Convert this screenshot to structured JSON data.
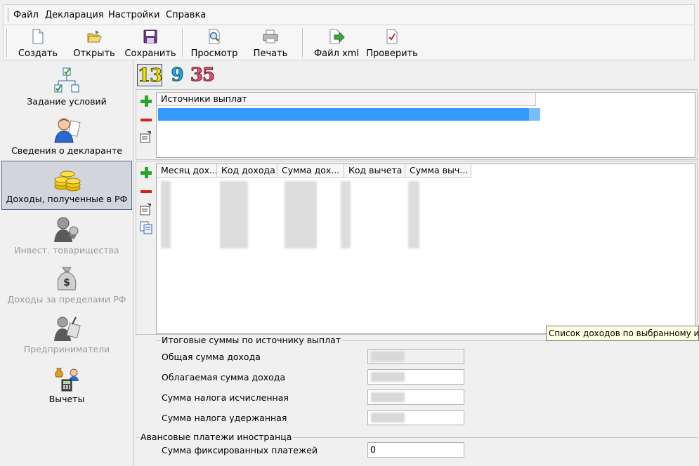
{
  "menu": [
    "Файл",
    "Декларация",
    "Настройки",
    "Справка"
  ],
  "toolbar": {
    "create": "Создать",
    "open": "Открыть",
    "save": "Сохранить",
    "preview": "Просмотр",
    "print": "Печать",
    "xml": "Файл xml",
    "check": "Проверить"
  },
  "sidebar": {
    "items": [
      {
        "label": "Задание условий",
        "icon": "conditions-icon"
      },
      {
        "label": "Сведения о декларанте",
        "icon": "declarant-icon"
      },
      {
        "label": "Доходы, полученные в РФ",
        "icon": "coins-icon"
      },
      {
        "label": "Инвест. товарищества",
        "icon": "partnership-icon"
      },
      {
        "label": "Доходы за пределами РФ",
        "icon": "money-bag-icon"
      },
      {
        "label": "Предприниматели",
        "icon": "entrepreneur-icon"
      },
      {
        "label": "Вычеты",
        "icon": "deductions-icon"
      }
    ],
    "active_index": 2
  },
  "tax_rates": [
    "13",
    "9",
    "35"
  ],
  "tax_rate_colors": [
    "#f5e800",
    "#22a6e0",
    "#e0506a"
  ],
  "sources_table": {
    "columns": [
      "Источники выплат"
    ]
  },
  "income_table": {
    "columns": [
      "Месяц дох...",
      "Код дохода",
      "Сумма дох...",
      "Код вычета",
      "Сумма выч..."
    ]
  },
  "totals": {
    "title": "Итоговые суммы по источнику выплат",
    "fields": [
      {
        "label": "Общая сумма дохода"
      },
      {
        "label": "Облагаемая сумма дохода"
      },
      {
        "label": "Сумма налога исчисленная"
      },
      {
        "label": "Сумма налога удержанная"
      }
    ]
  },
  "advance": {
    "title": "Авансовые платежи иностранца",
    "label": "Сумма фиксированных платежей",
    "value": "0"
  },
  "tooltip": "Список доходов по выбранному источ"
}
